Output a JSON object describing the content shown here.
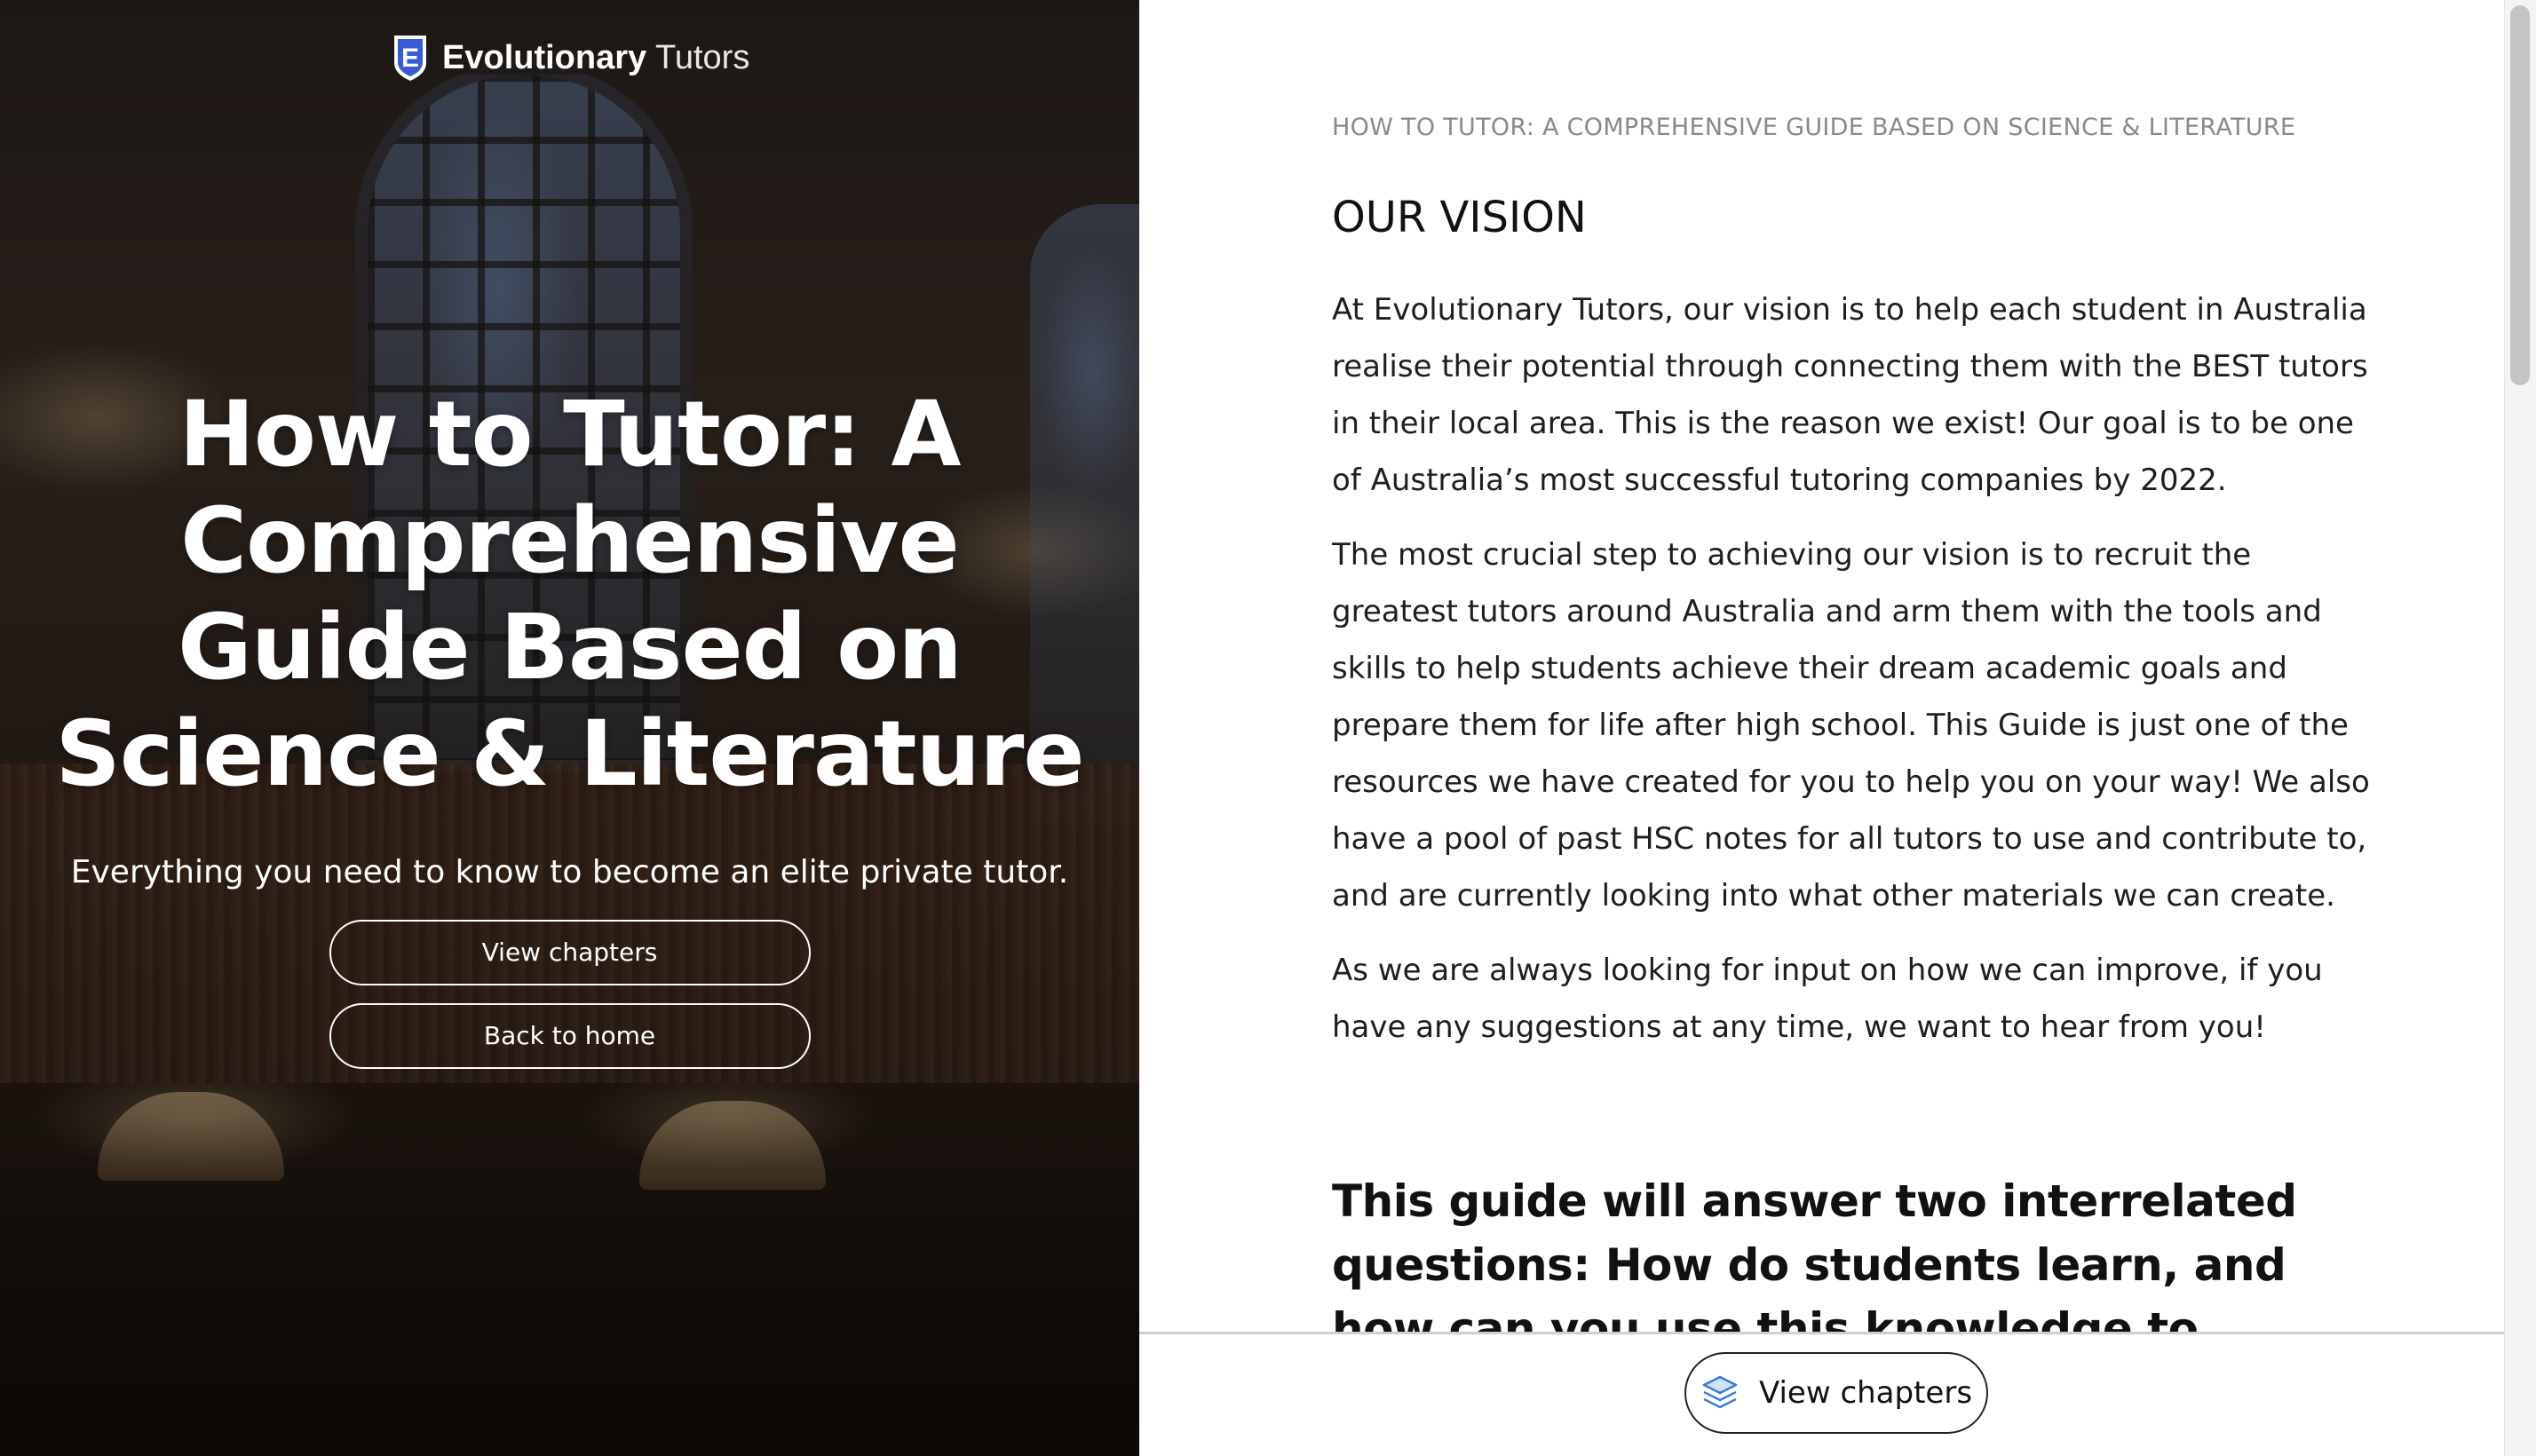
{
  "brand": {
    "name_bold": "Evolutionary",
    "name_light": "Tutors",
    "shield_letter": "E"
  },
  "hero": {
    "title_lines": [
      "How to Tutor: A",
      "Comprehensive",
      "Guide Based on",
      "Science & Literature"
    ],
    "subtitle": "Everything you need to know to become an elite private tutor.",
    "view_chapters_label": "View chapters",
    "back_home_label": "Back to home"
  },
  "article": {
    "breadcrumb": "HOW TO TUTOR: A COMPREHENSIVE GUIDE BASED ON SCIENCE & LITERATURE",
    "section_heading": "OUR VISION",
    "paragraphs": [
      "At Evolutionary Tutors, our vision is to help each student in Australia realise their potential through connecting them with the BEST tutors in their local area. This is the reason we exist! Our goal is to be one of Australia’s most successful tutoring companies by 2022.",
      "The most crucial step to achieving our vision is to recruit the greatest tutors around Australia and arm them with the tools and skills to help students achieve their dream academic goals and prepare them for life after high school. This Guide is just one of the resources we have created for you to help you on your way! We also have a pool of past HSC notes for all tutors to use and contribute to, and are currently looking into what other materials we can create.",
      "As we are always looking for input on how we can improve, if you have any suggestions at any time, we want to hear from you!"
    ],
    "guide_heading": "This guide will answer two interrelated questions: How do students learn, and how can you use this knowledge to become an excellent tutor?"
  },
  "bottom_bar": {
    "chapters_label": "View chapters",
    "icon": "layers-icon"
  },
  "colors": {
    "hero_text": "#ffffff",
    "breadcrumb": "#8a8a8a",
    "body_text": "#1e1e1e",
    "shield_blue": "#3b5bd6",
    "layers_blue": "#3a7bd5"
  }
}
